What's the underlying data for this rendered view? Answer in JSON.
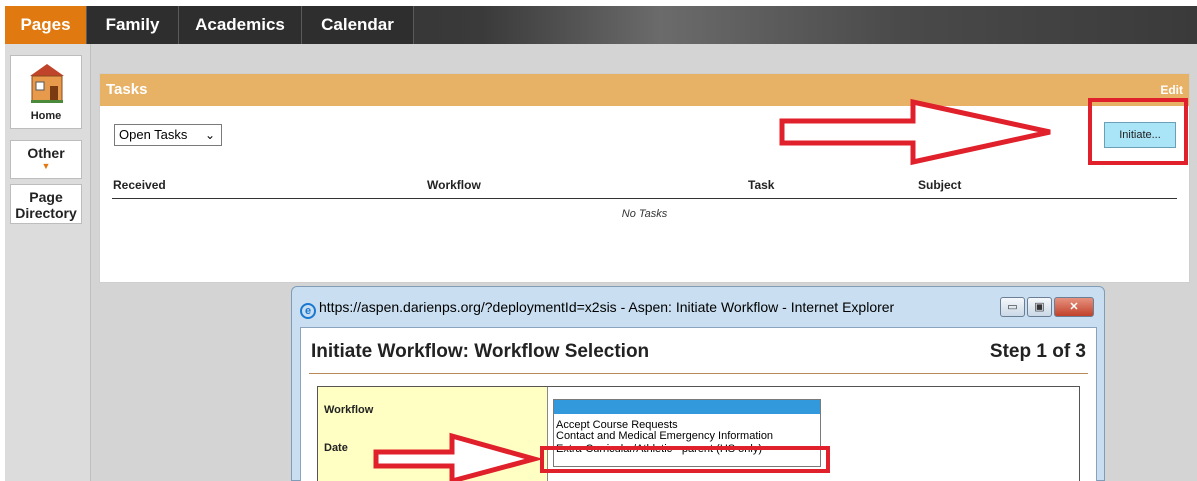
{
  "nav": {
    "tabs": [
      "Pages",
      "Family",
      "Academics",
      "Calendar"
    ]
  },
  "sidebar": {
    "home_label": "Home",
    "other_label": "Other",
    "page_directory_label": "Page Directory"
  },
  "tasks_panel": {
    "title": "Tasks",
    "edit_label": "Edit",
    "filter_selected": "Open Tasks",
    "initiate_label": "Initiate...",
    "columns": [
      "Received",
      "Workflow",
      "Task",
      "Subject"
    ],
    "empty_message": "No Tasks"
  },
  "popup": {
    "window_title": "https://aspen.darienps.org/?deploymentId=x2sis - Aspen: Initiate Workflow - Internet Explorer",
    "heading": "Initiate Workflow: Workflow Selection",
    "step": "Step 1 of 3",
    "form_labels": [
      "Workflow",
      "Date"
    ],
    "workflow_options": [
      "Accept Course Requests",
      "Contact and Medical Emergency Information",
      "Extra-Curricular/Athletic - parent (HS only)"
    ]
  },
  "colors": {
    "accent_orange": "#e07a10",
    "panel_header": "#e8b266",
    "annotation_red": "#e0202a",
    "initiate_button": "#a9e4f7"
  },
  "icons": [
    "house-icon",
    "dropdown-arrow-icon",
    "chevron-down-icon",
    "ie-icon",
    "minimize-icon",
    "maximize-icon",
    "close-icon"
  ]
}
